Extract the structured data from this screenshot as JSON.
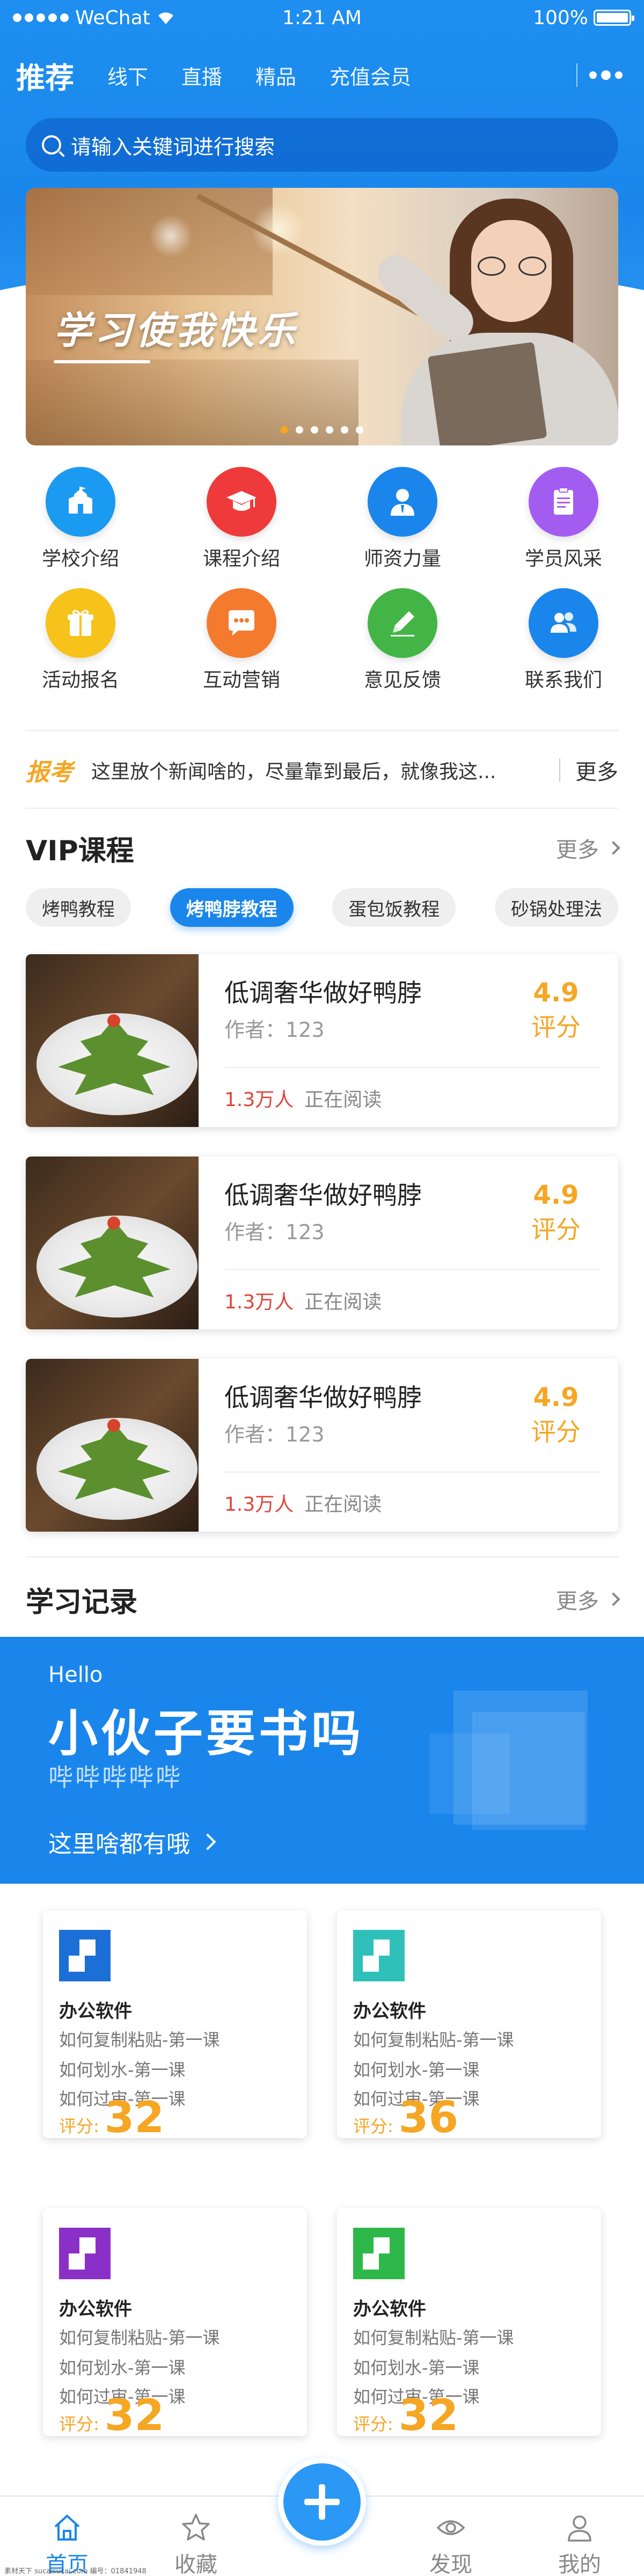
{
  "status_bar": {
    "carrier": "WeChat",
    "time": "1:21 AM",
    "battery": "100%"
  },
  "top_nav": {
    "tabs": [
      "推荐",
      "线下",
      "直播",
      "精品",
      "充值会员"
    ],
    "active_index": 0
  },
  "search": {
    "placeholder": "请输入关键词进行搜索"
  },
  "banner": {
    "title": "学习使我快乐",
    "slides": 6,
    "active_slide": 0
  },
  "grid": [
    {
      "label": "学校介绍",
      "icon": "school-icon",
      "color": "#1a9af0"
    },
    {
      "label": "课程介绍",
      "icon": "graduation-cap-icon",
      "color": "#ee3a3a"
    },
    {
      "label": "师资力量",
      "icon": "teacher-icon",
      "color": "#1a86ec"
    },
    {
      "label": "学员风采",
      "icon": "clipboard-icon",
      "color": "#a35cf0"
    },
    {
      "label": "活动报名",
      "icon": "gift-icon",
      "color": "#f7c21a"
    },
    {
      "label": "互动营销",
      "icon": "chat-bubble-icon",
      "color": "#f47a2e"
    },
    {
      "label": "意见反馈",
      "icon": "pencil-icon",
      "color": "#43b547"
    },
    {
      "label": "联系我们",
      "icon": "contacts-icon",
      "color": "#1a86ec"
    }
  ],
  "news": {
    "tag": "报考",
    "text": "这里放个新闻啥的，尽量靠到最后，就像我这...",
    "more": "更多"
  },
  "vip": {
    "title": "VIP课程",
    "more": "更多",
    "chips": [
      "烤鸭教程",
      "烤鸭脖教程",
      "蛋包饭教程",
      "砂锅处理法"
    ],
    "active_chip": 1,
    "courses": [
      {
        "title": "低调奢华做好鸭脖",
        "author": "作者：123",
        "readers": "1.3万人",
        "reading": "正在阅读",
        "score": "4.9",
        "score_label": "评分"
      },
      {
        "title": "低调奢华做好鸭脖",
        "author": "作者：123",
        "readers": "1.3万人",
        "reading": "正在阅读",
        "score": "4.9",
        "score_label": "评分"
      },
      {
        "title": "低调奢华做好鸭脖",
        "author": "作者：123",
        "readers": "1.3万人",
        "reading": "正在阅读",
        "score": "4.9",
        "score_label": "评分"
      }
    ]
  },
  "records": {
    "title": "学习记录",
    "more": "更多",
    "promo": {
      "hello": "Hello",
      "title": "小伙子要书吗",
      "subtitle": "哔哔哔哔哔",
      "link": "这里啥都有哦"
    },
    "cards": [
      {
        "title": "办公软件",
        "lines": [
          "如何复制粘贴-第一课",
          "如何划水-第一课",
          "如何过审-第一课"
        ],
        "score_label": "评分:",
        "score": "32",
        "color": "#1d6fd8"
      },
      {
        "title": "办公软件",
        "lines": [
          "如何复制粘贴-第一课",
          "如何划水-第一课",
          "如何过审-第一课"
        ],
        "score_label": "评分:",
        "score": "36",
        "color": "#2fc1b9"
      },
      {
        "title": "办公软件",
        "lines": [
          "如何复制粘贴-第一课",
          "如何划水-第一课",
          "如何过审-第一课"
        ],
        "score_label": "评分:",
        "score": "32",
        "color": "#8b2fc9"
      },
      {
        "title": "办公软件",
        "lines": [
          "如何复制粘贴-第一课",
          "如何划水-第一课",
          "如何过审-第一课"
        ],
        "score_label": "评分:",
        "score": "32",
        "color": "#2fb84a"
      }
    ]
  },
  "tabbar": {
    "tabs": [
      "首页",
      "收藏",
      "发现",
      "我的"
    ],
    "active_index": 0
  },
  "watermark": "素材天下 sucaisucai.com   编号：01841948"
}
